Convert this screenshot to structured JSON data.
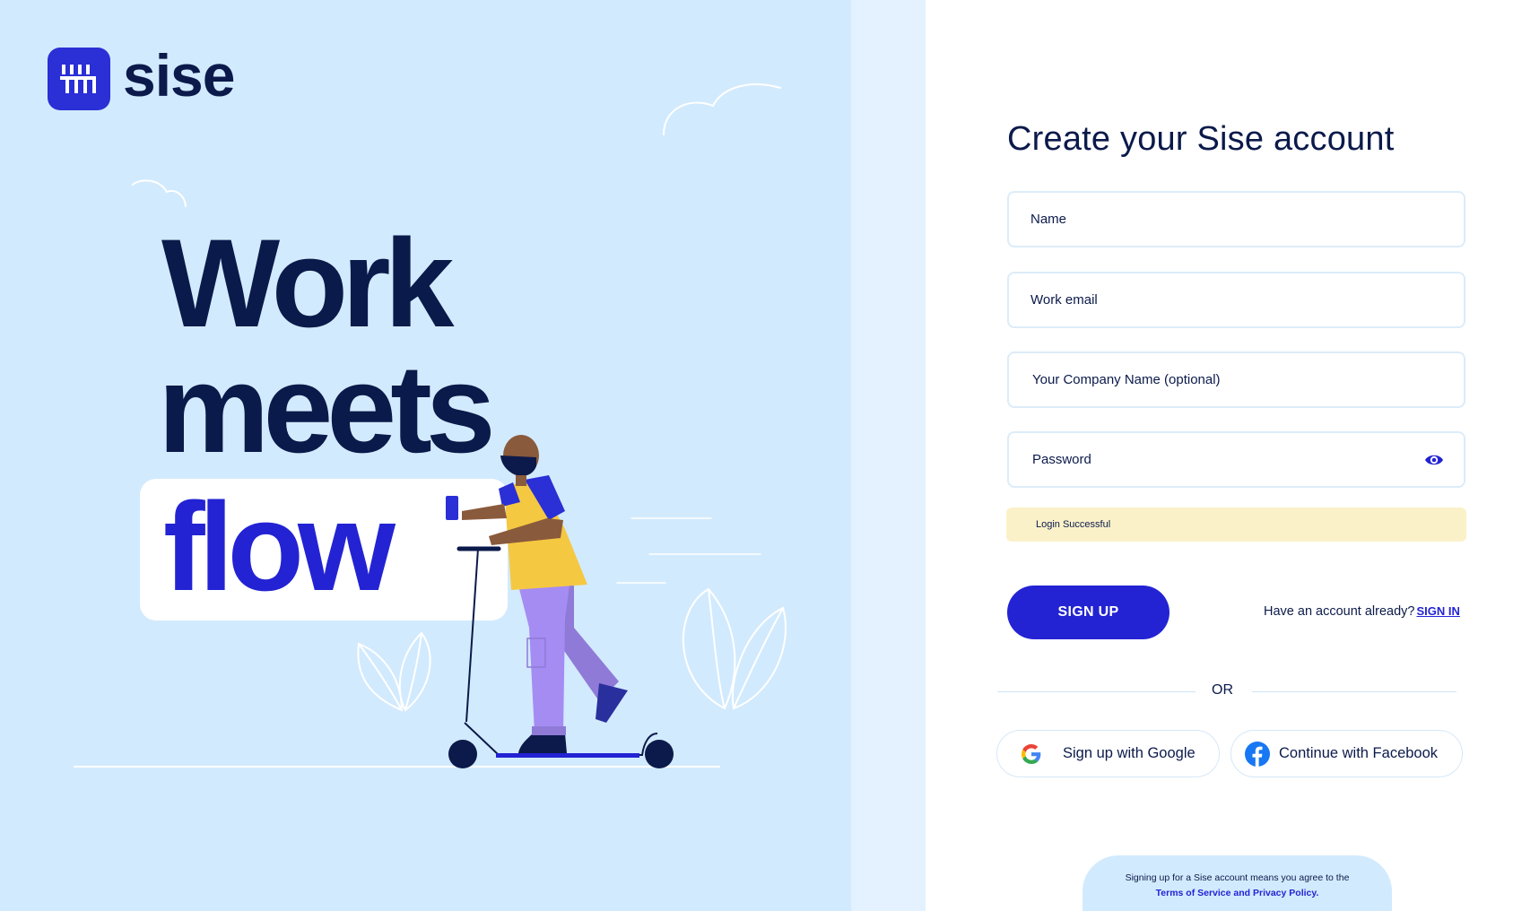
{
  "brand": {
    "name": "sise",
    "color": "#2a2fd6",
    "ink": "#0b1a4a"
  },
  "hero": {
    "line1": "Work",
    "line2": "meets",
    "line3": "flow"
  },
  "form": {
    "title": "Create your Sise account",
    "name_placeholder": "Name",
    "email_placeholder": "Work email",
    "company_placeholder": "Your Company Name (optional)",
    "password_placeholder": "Password",
    "password_toggle_icon": "eye-icon",
    "alert_message": "Login Successful",
    "signup_label": "SIGN UP",
    "have_account_text": "Have an account already?",
    "signin_label": "SIGN IN",
    "or_text": "OR",
    "google_label": "Sign up with Google",
    "facebook_label": "Continue with Facebook",
    "terms_text": "Signing up for a Sise account means you agree to the",
    "terms_link": "Terms of Service and Privacy Policy."
  },
  "colors": {
    "accent": "#2323d4",
    "left_bg": "#d2eafd",
    "alert_bg": "#fbf1c9",
    "figure_shirt": "#f5c842",
    "figure_pants": "#a58cf2"
  }
}
